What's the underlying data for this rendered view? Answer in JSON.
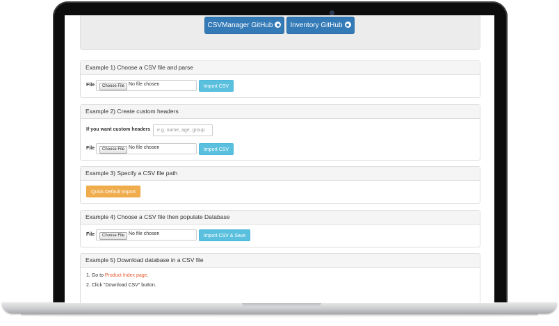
{
  "hero": {
    "buttons": [
      {
        "label": "CSVManager GitHub",
        "icon": "github-icon"
      },
      {
        "label": "Inventory GitHub",
        "icon": "github-icon"
      }
    ]
  },
  "panels": [
    {
      "title": "Example 1) Choose a CSV file and parse",
      "file_label": "File",
      "choose_label": "Choose File",
      "no_file": "No file chosen",
      "button": "Import CSV"
    },
    {
      "title": "Example 2) Create custom headers",
      "headers_label": "If you want custom headers",
      "headers_placeholder": "e.g. name, age, group",
      "file_label": "File",
      "choose_label": "Choose File",
      "no_file": "No file chosen",
      "button": "Import CSV"
    },
    {
      "title": "Example 3) Specify a CSV file path",
      "button": "Quick Default Import"
    },
    {
      "title": "Example 4) Choose a CSV file then populate Database",
      "file_label": "File",
      "choose_label": "Choose File",
      "no_file": "No file chosen",
      "button": "Import CSV & Save"
    },
    {
      "title": "Example 5) Download database in a CSV file",
      "step1_prefix": "1. Go to",
      "step1_link": "Product Index page",
      "step1_suffix": ".",
      "step2": "2. Click \"Download CSV\" button."
    }
  ],
  "colors": {
    "primary": "#337ab7",
    "info": "#5bc0de",
    "warning": "#f0ad4e",
    "link": "#e8552a"
  }
}
